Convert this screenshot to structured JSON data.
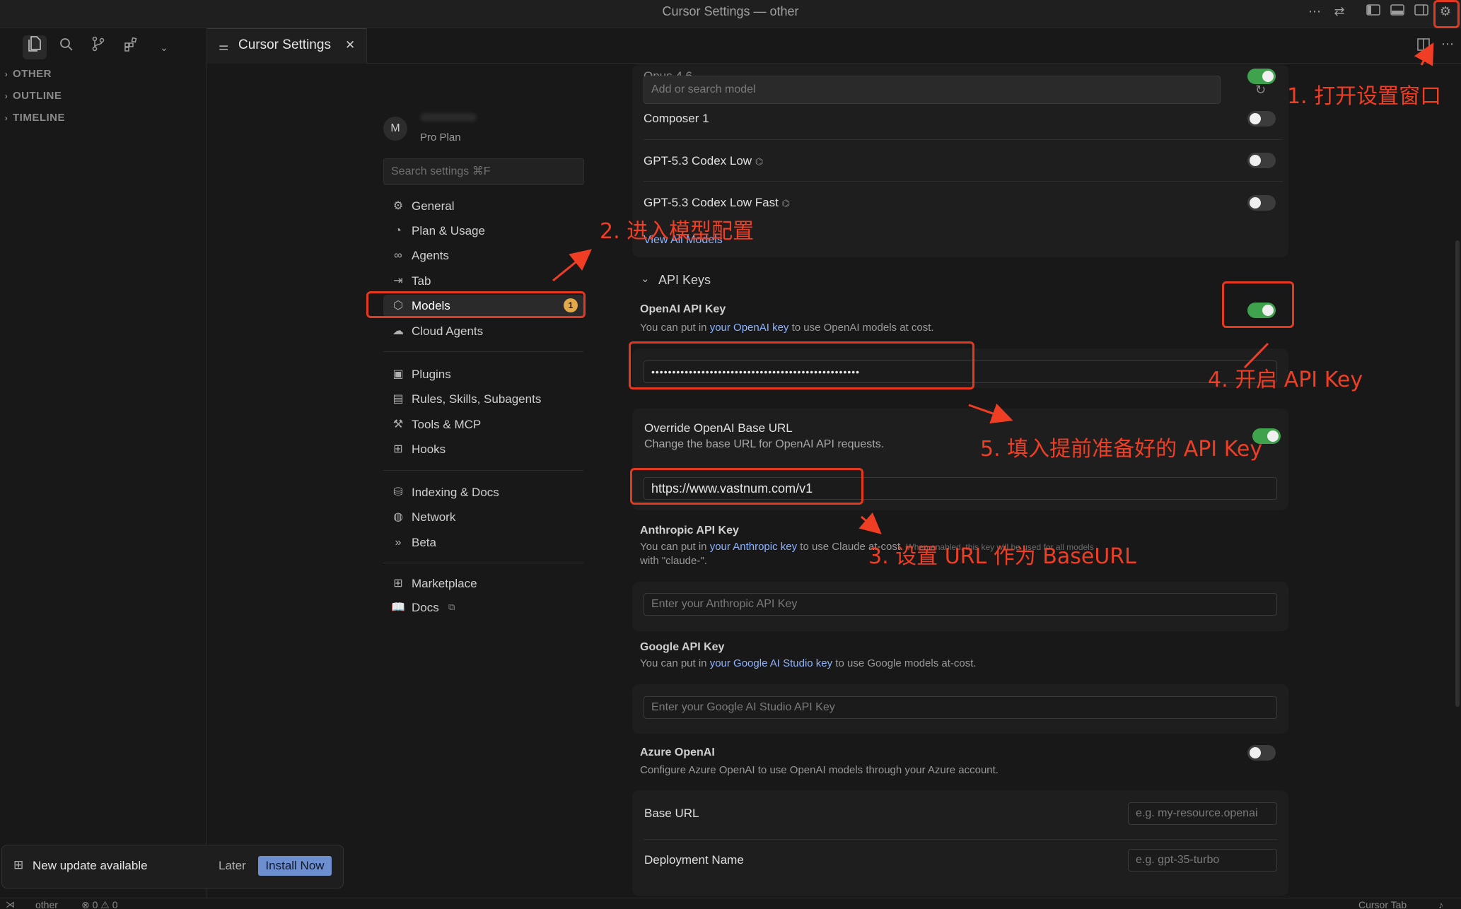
{
  "window": {
    "title": "Cursor Settings — other"
  },
  "tab": {
    "label": "Cursor Settings",
    "close_glyph": "✕"
  },
  "sidebar": {
    "sections": [
      "OTHER",
      "OUTLINE",
      "TIMELINE"
    ]
  },
  "account": {
    "avatar_letter": "M",
    "plan": "Pro Plan"
  },
  "search": {
    "placeholder": "Search settings ⌘F"
  },
  "nav": {
    "group1": [
      {
        "label": "General",
        "icon": "gear-icon"
      },
      {
        "label": "Plan & Usage",
        "icon": "gauge-icon"
      },
      {
        "label": "Agents",
        "icon": "infinity-icon"
      },
      {
        "label": "Tab",
        "icon": "tab-arrow-icon"
      },
      {
        "label": "Models",
        "icon": "cube-icon",
        "badge": "1"
      },
      {
        "label": "Cloud Agents",
        "icon": "cloud-icon"
      }
    ],
    "group2": [
      {
        "label": "Plugins",
        "icon": "package-icon"
      },
      {
        "label": "Rules, Skills, Subagents",
        "icon": "clipboard-icon"
      },
      {
        "label": "Tools & MCP",
        "icon": "tools-icon"
      },
      {
        "label": "Hooks",
        "icon": "hooks-icon"
      }
    ],
    "group3": [
      {
        "label": "Indexing & Docs",
        "icon": "database-icon"
      },
      {
        "label": "Network",
        "icon": "globe-icon"
      },
      {
        "label": "Beta",
        "icon": "beta-icon"
      }
    ],
    "group4": [
      {
        "label": "Marketplace",
        "icon": "marketplace-icon"
      },
      {
        "label": "Docs",
        "icon": "book-icon"
      }
    ]
  },
  "models": {
    "partial_top": "Opus 4.6",
    "add_placeholder": "Add or search model",
    "items": [
      {
        "name": "Composer 1",
        "enabled": false
      },
      {
        "name": "GPT-5.3 Codex Low",
        "enabled": false
      },
      {
        "name": "GPT-5.3 Codex Low Fast",
        "enabled": false
      }
    ],
    "view_all": "View All Models"
  },
  "api_keys": {
    "header": "API Keys",
    "openai": {
      "title": "OpenAI API Key",
      "desc_pre": "You can put in ",
      "desc_link": "your OpenAI key",
      "desc_post": " to use OpenAI models at cost.",
      "value": "••••••••••••••••••••••••••••••••••••••••••••••••••",
      "enabled": true
    },
    "override": {
      "title": "Override OpenAI Base URL",
      "desc": "Change the base URL for OpenAI API requests.",
      "value": "https://www.vastnum.com/v1",
      "enabled": true
    },
    "anthropic": {
      "title": "Anthropic API Key",
      "desc_pre": "You can put in ",
      "desc_link": "your Anthropic key",
      "desc_post": " to use Claude at-cost.",
      "desc_faded": "When enabled, this key will be used for all models",
      "desc_line2": "with \"claude-\".",
      "placeholder": "Enter your Anthropic API Key"
    },
    "google": {
      "title": "Google API Key",
      "desc_pre": "You can put in ",
      "desc_link": "your Google AI Studio key",
      "desc_post": " to use Google models at-cost.",
      "placeholder": "Enter your Google AI Studio API Key"
    },
    "azure": {
      "title": "Azure OpenAI",
      "desc": "Configure Azure OpenAI to use OpenAI models through your Azure account.",
      "enabled": false,
      "base_url_label": "Base URL",
      "base_url_placeholder": "e.g. my-resource.openai",
      "deployment_label": "Deployment Name",
      "deployment_placeholder": "e.g. gpt-35-turbo"
    }
  },
  "annotations": {
    "step1": "1. 打开设置窗口",
    "step2": "2. 进入模型配置",
    "step3": "3. 设置 URL 作为 BaseURL",
    "step4": "4. 开启 API Key",
    "step5": "5. 填入提前准备好的 API Key"
  },
  "toast": {
    "message": "New update available",
    "later": "Later",
    "install": "Install Now"
  },
  "statusbar": {
    "branch": "other",
    "errors": "0",
    "warnings": "0",
    "right": "Cursor Tab"
  },
  "colors": {
    "accent_red": "#ef3e24",
    "toggle_on": "#3fa34d",
    "link": "#8fb4ff",
    "install_btn": "#6d8fcf"
  }
}
